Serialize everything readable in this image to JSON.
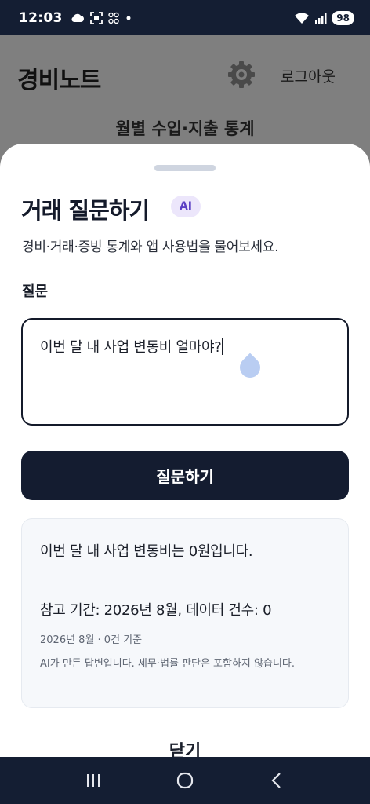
{
  "status_bar": {
    "time": "12:03",
    "battery": "98"
  },
  "background_app": {
    "title": "경비노트",
    "logout_label": "로그아웃",
    "subtitle": "월별 수입·지출 통계"
  },
  "sheet": {
    "title": "거래 질문하기",
    "ai_badge": "AI",
    "description": "경비·거래·증빙 통계와 앱 사용법을 물어보세요.",
    "question_label": "질문",
    "question_value": "이번 달 내 사업 변동비 얼마야?",
    "submit_label": "질문하기",
    "answer": {
      "main": "이번 달 내 사업 변동비는 0원입니다.",
      "reference": "참고 기간: 2026년 8월, 데이터 건수: 0",
      "meta": "2026년 8월 · 0건 기준",
      "note": "AI가 만든 답변입니다. 세무·법률 판단은 포함하지 않습니다."
    },
    "close_label": "닫기"
  },
  "colors": {
    "navy": "#141c30",
    "ai_badge_bg": "#ece6fb",
    "ai_badge_text": "#5b3fc4"
  },
  "icons": {
    "status": [
      "cloud-icon",
      "screenshot-icon",
      "grid-app-icon",
      "dot-icon",
      "wifi-icon",
      "signal-icon"
    ],
    "nav": [
      "recent-apps-icon",
      "home-icon",
      "back-icon"
    ]
  }
}
